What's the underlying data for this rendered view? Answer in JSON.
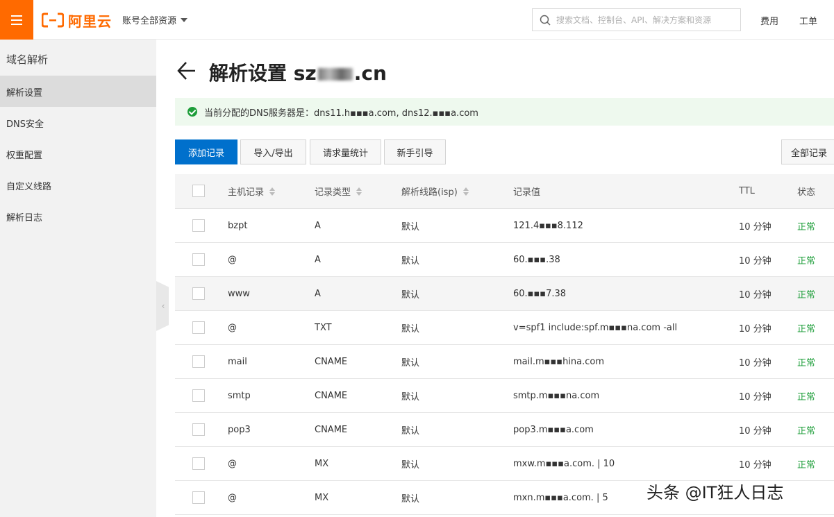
{
  "header": {
    "logo_text": "阿里云",
    "account_menu": "账号全部资源",
    "search_placeholder": "搜索文档、控制台、API、解决方案和资源",
    "links": [
      "费用",
      "工单"
    ]
  },
  "sidebar": {
    "title": "域名解析",
    "items": [
      {
        "label": "解析设置",
        "active": true
      },
      {
        "label": "DNS安全",
        "active": false
      },
      {
        "label": "权重配置",
        "active": false
      },
      {
        "label": "自定义线路",
        "active": false
      },
      {
        "label": "解析日志",
        "active": false
      }
    ]
  },
  "page": {
    "title_prefix": "解析设置 sz",
    "title_suffix": ".cn",
    "notice": "当前分配的DNS服务器是：dns11.h▪▪▪a.com, dns12.▪▪▪a.com"
  },
  "toolbar": {
    "add": "添加记录",
    "import_export": "导入/导出",
    "stats": "请求量统计",
    "guide": "新手引导",
    "all_records": "全部记录"
  },
  "table": {
    "headers": {
      "host": "主机记录",
      "type": "记录类型",
      "line": "解析线路(isp)",
      "value": "记录值",
      "ttl": "TTL",
      "status": "状态"
    },
    "rows": [
      {
        "host": "bzpt",
        "type": "A",
        "line": "默认",
        "value": "121.4▪▪▪8.112",
        "ttl": "10 分钟",
        "status": "正常"
      },
      {
        "host": "@",
        "type": "A",
        "line": "默认",
        "value": "60.▪▪▪.38",
        "ttl": "10 分钟",
        "status": "正常"
      },
      {
        "host": "www",
        "type": "A",
        "line": "默认",
        "value": "60.▪▪▪7.38",
        "ttl": "10 分钟",
        "status": "正常"
      },
      {
        "host": "@",
        "type": "TXT",
        "line": "默认",
        "value": "v=spf1 include:spf.m▪▪▪na.com -all",
        "ttl": "10 分钟",
        "status": "正常"
      },
      {
        "host": "mail",
        "type": "CNAME",
        "line": "默认",
        "value": "mail.m▪▪▪hina.com",
        "ttl": "10 分钟",
        "status": "正常"
      },
      {
        "host": "smtp",
        "type": "CNAME",
        "line": "默认",
        "value": "smtp.m▪▪▪na.com",
        "ttl": "10 分钟",
        "status": "正常"
      },
      {
        "host": "pop3",
        "type": "CNAME",
        "line": "默认",
        "value": "pop3.m▪▪▪a.com",
        "ttl": "10 分钟",
        "status": "正常"
      },
      {
        "host": "@",
        "type": "MX",
        "line": "默认",
        "value": "mxw.m▪▪▪a.com. | 10",
        "ttl": "10 分钟",
        "status": "正常"
      },
      {
        "host": "@",
        "type": "MX",
        "line": "默认",
        "value": "mxn.m▪▪▪a.com. | 5",
        "ttl": "",
        "status": ""
      }
    ]
  },
  "watermark": "头条 @IT狂人日志",
  "colors": {
    "brand": "#ff6a00",
    "primary": "#0070cc",
    "success": "#1e9e3a"
  }
}
